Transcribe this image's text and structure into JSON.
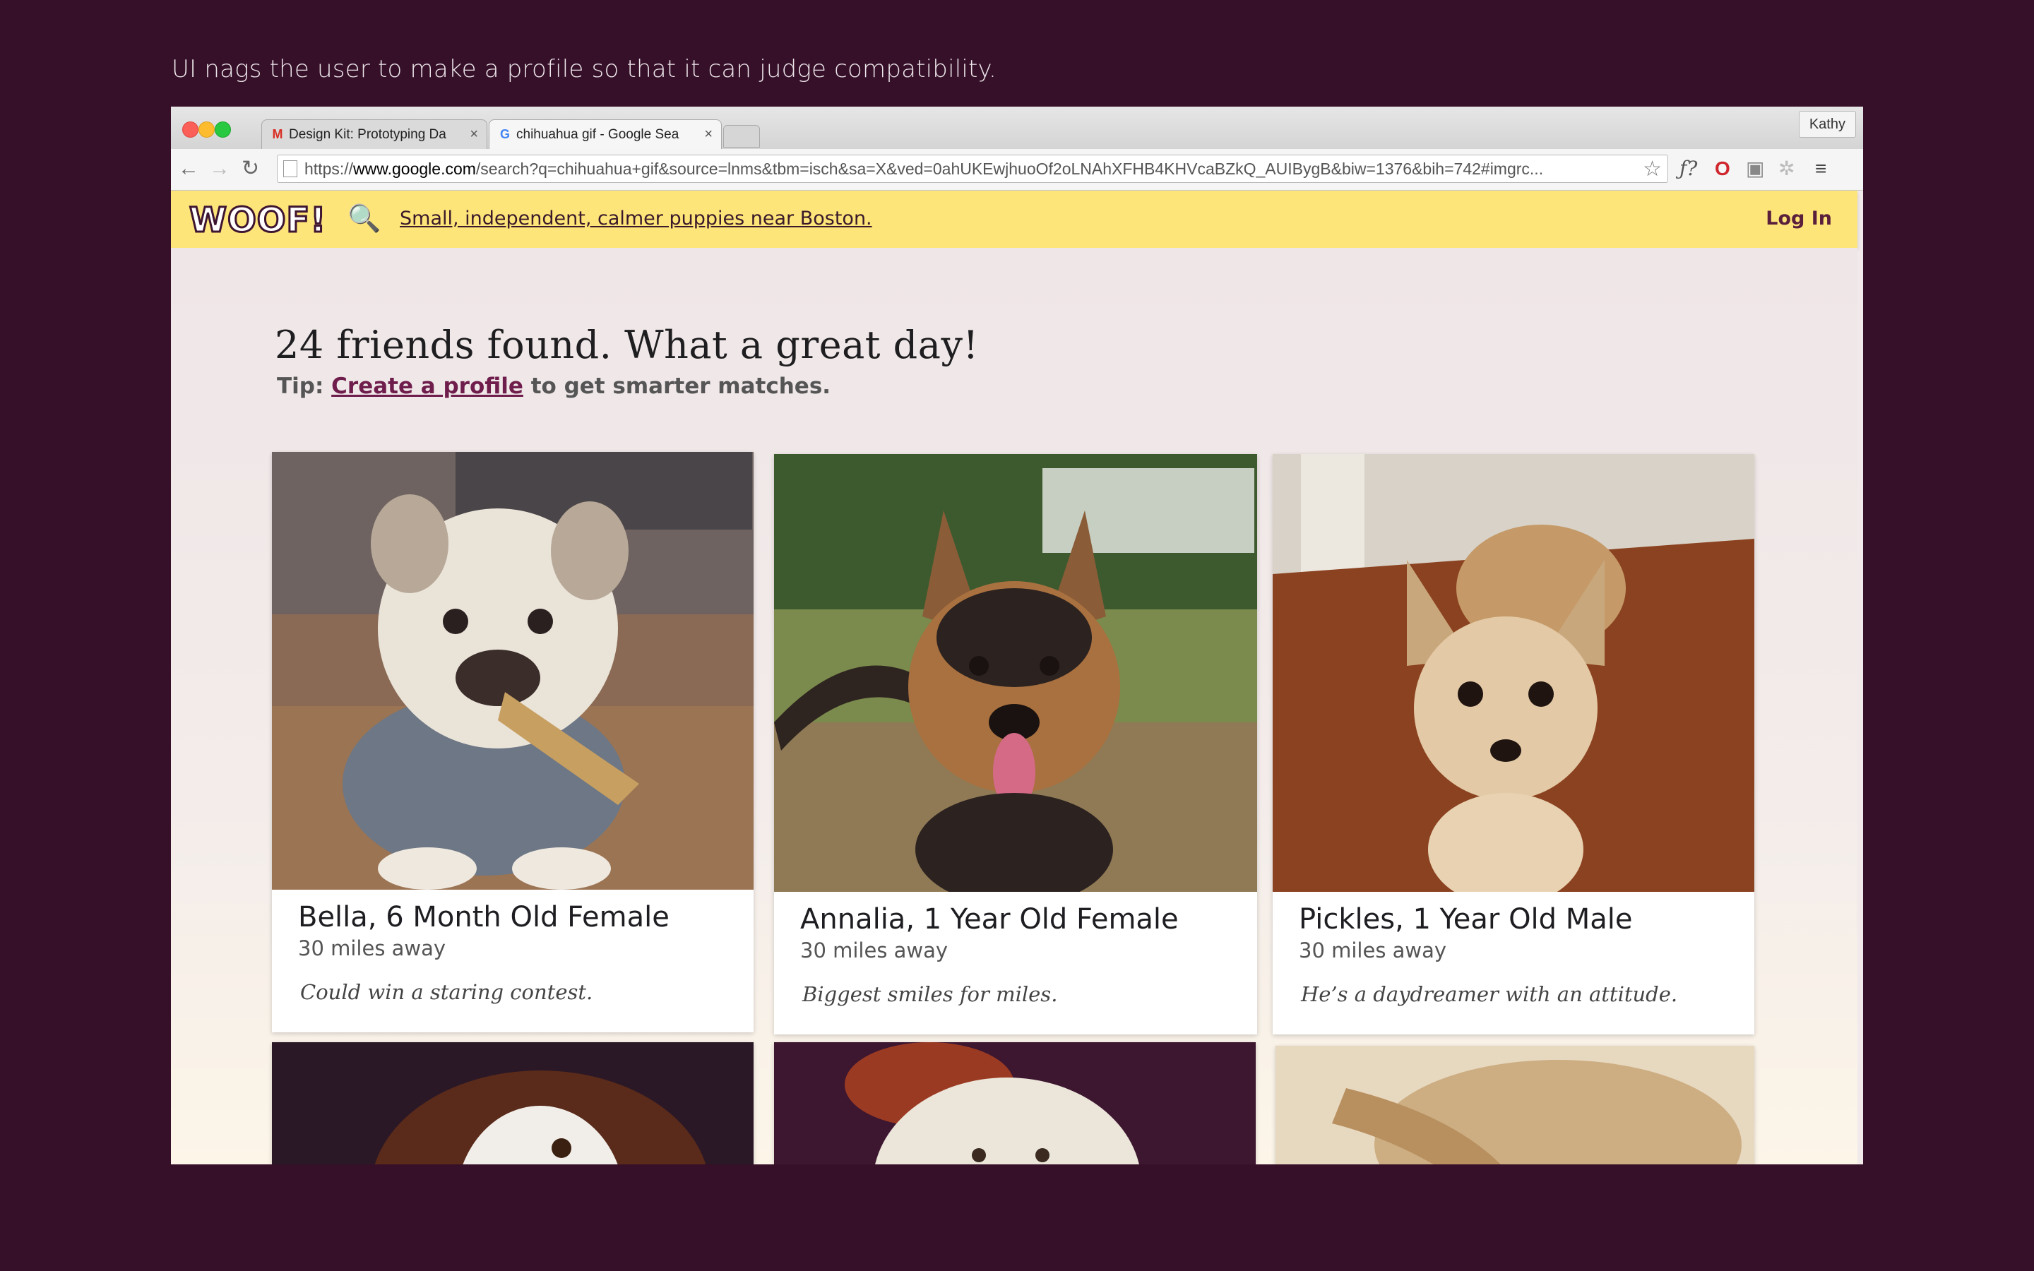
{
  "caption": "UI nags the user to make a profile so that it can judge compatibility.",
  "browser": {
    "tabs": [
      {
        "label": "Design Kit: Prototyping Da",
        "favicon": "gmail-icon"
      },
      {
        "label": "chihuahua gif - Google Sea",
        "favicon": "google-icon"
      }
    ],
    "profile": "Kathy",
    "url_scheme": "https://",
    "url_domain": "www.google.com",
    "url_rest": "/search?q=chihuahua+gif&source=lnms&tbm=isch&sa=X&ved=0ahUKEwjhuoOf2oLNAhXFHB4KHVcaBZkQ_AUIBygB&biw=1376&bih=742#imgrc..."
  },
  "site": {
    "logo": "WOOF!",
    "search_query": "Small, independent, calmer puppies near Boston.",
    "login": "Log In"
  },
  "results": {
    "headline": "24 friends found. What a great day!",
    "tip_prefix": "Tip:",
    "tip_link": "Create a profile",
    "tip_suffix": "to get smarter matches."
  },
  "dogs": [
    {
      "name": "Bella, 6 Month Old Female",
      "distance": "30 miles away",
      "blurb": "Could win a staring contest."
    },
    {
      "name": "Annalia, 1 Year Old Female",
      "distance": "30 miles away",
      "blurb": "Biggest smiles for miles."
    },
    {
      "name": "Pickles, 1 Year Old Male",
      "distance": "30 miles away",
      "blurb": "He’s a daydreamer with an attitude."
    }
  ]
}
